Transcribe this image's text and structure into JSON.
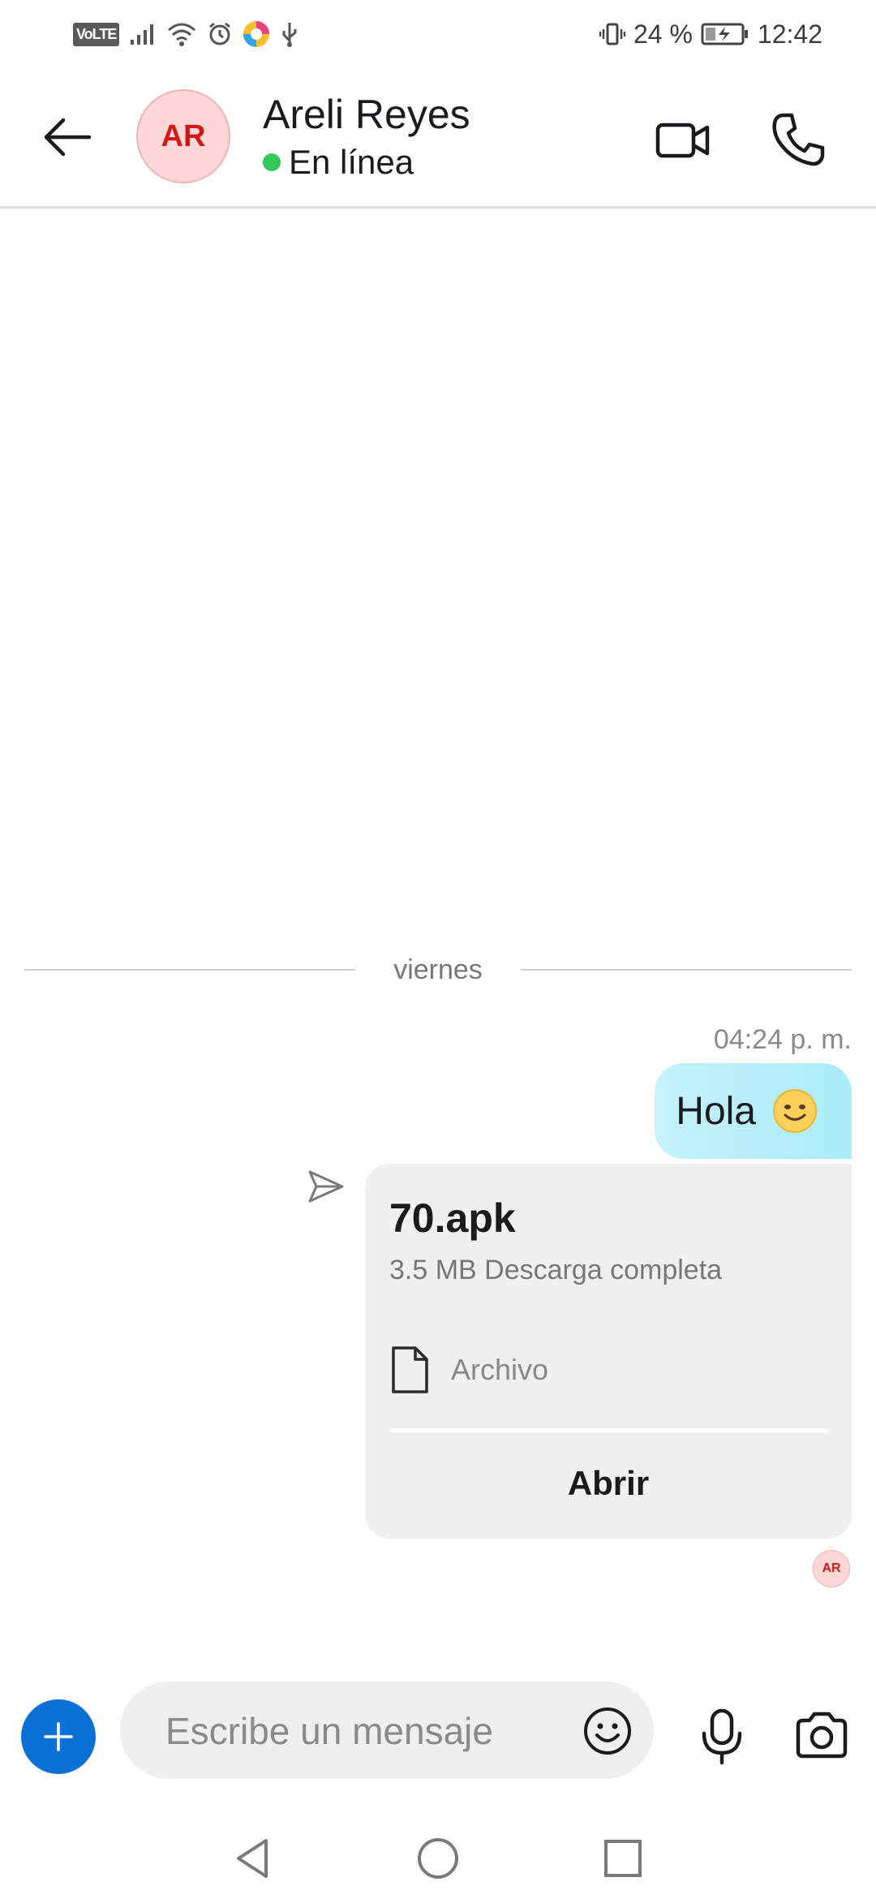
{
  "status_bar": {
    "network_badge": "VoLTE",
    "battery_percent": "24 %",
    "time": "12:42",
    "icons": [
      "signal-icon",
      "wifi-icon",
      "alarm-icon",
      "app-icon",
      "usb-icon",
      "vibrate-icon",
      "battery-icon"
    ]
  },
  "header": {
    "avatar_initials": "AR",
    "contact_name": "Areli Reyes",
    "presence": "En línea",
    "presence_color": "#34c759",
    "icons": [
      "back-arrow-icon",
      "video-call-icon",
      "phone-call-icon"
    ]
  },
  "chat": {
    "day_divider": "viernes",
    "timestamp": "04:24 p. m.",
    "text_message": "Hola",
    "file": {
      "name": "70.apk",
      "meta": "3.5 MB Descarga completa",
      "type_label": "Archivo",
      "open_label": "Abrir"
    },
    "read_receipt_initials": "AR"
  },
  "composer": {
    "placeholder": "Escribe un mensaje",
    "accent_color": "#0a72d6"
  }
}
